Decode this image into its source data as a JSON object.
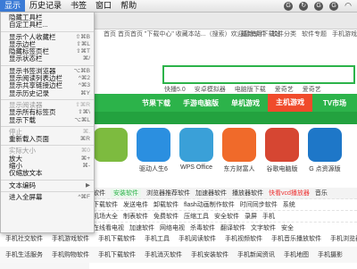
{
  "menubar": {
    "items": [
      "显示",
      "历史记录",
      "书签",
      "窗口",
      "帮助"
    ],
    "active_index": 0
  },
  "status_icons": [
    "g-icon",
    "refresh-icon",
    "g-icon",
    "g-icon",
    "wifi-icon"
  ],
  "infobar": {
    "left": "首页 首页首页 \"下载中心\" 收藏本站...（搜索）欢迎您使用下载站",
    "links": [
      "最新软件",
      "软件分类",
      "软件专题",
      "手机游戏"
    ]
  },
  "hot_links": [
    "快播5.0",
    "安卓模拟器",
    "电脑版下载",
    "爱奇艺",
    "爱奇艺"
  ],
  "nav": [
    "",
    "节果下载",
    "手游电脑版",
    "单机游戏",
    "主机游戏",
    "TV市场"
  ],
  "nav_hot_index": 4,
  "apps": [
    {
      "label": "",
      "color": "#7dbb3f"
    },
    {
      "label": "驱动人生6",
      "color": "#2b8fe0"
    },
    {
      "label": "WPS Office",
      "color": "#3aa0d8"
    },
    {
      "label": "东方财富人",
      "color": "#f06a2a"
    },
    {
      "label": "谷歌电脑版",
      "color": "#d64632"
    },
    {
      "label": "G 点资源版",
      "color": "#1e77c8"
    }
  ],
  "categories": [
    {
      "items": [
        "软件",
        "安装软件",
        "浏览器推荐软件",
        "加速器软件",
        "播放器软件",
        "快看vcd播放器",
        "音乐"
      ],
      "green_index": 1,
      "red_index": 5
    },
    {
      "items": [
        "下载软件",
        "发送电件",
        "卸载软件",
        "flash动画制作软件",
        "时间同步软件",
        "系统"
      ],
      "green_index": -1,
      "red_index": -1
    },
    {
      "items": [
        "机场大全",
        "制表软件",
        "免费软件",
        "压缩工具",
        "安全软件",
        "录屏",
        "手机"
      ],
      "green_index": -1,
      "red_index": -1
    },
    {
      "items": [
        "在线看电视",
        "加速软件",
        "网络电视",
        "杀毒软件",
        "翻译软件",
        "文字软件",
        "安全"
      ],
      "green_index": -1,
      "red_index": -1
    },
    {
      "items": [
        "文件",
        "电视直播",
        "下载工具",
        "电脑工具",
        "截图软件",
        "加速"
      ],
      "green_index": -1,
      "red_index": -1
    }
  ],
  "bottom_rows": [
    [
      "手机社交软件",
      "手机游戏软件",
      "手机下载软件",
      "手机工具",
      "手机阅读软件",
      "手机视频软件",
      "手机音乐播放软件",
      "手机浏览器"
    ],
    [
      "手机生活服务",
      "手机购物软件",
      "手机下载软件",
      "手机消灭软件",
      "手机安装软件",
      "手机新闻资讯",
      "手机地图",
      "手机摄影"
    ]
  ],
  "menu": {
    "groups": [
      [
        {
          "label": "隐藏工具栏",
          "shortcut": "",
          "enabled": true
        },
        {
          "label": "自定工具栏...",
          "shortcut": "",
          "enabled": true
        }
      ],
      [
        {
          "label": "显示个人收藏栏",
          "shortcut": "⇧⌘B",
          "enabled": true
        },
        {
          "label": "显示边栏",
          "shortcut": "⇧⌘L",
          "enabled": true
        },
        {
          "label": "隐藏标签页栏",
          "shortcut": "⇧⌘T",
          "enabled": true
        },
        {
          "label": "显示状态栏",
          "shortcut": "⌘/",
          "enabled": true
        }
      ],
      [
        {
          "label": "显示书签浏览器",
          "shortcut": "⌥⌘B",
          "enabled": true
        },
        {
          "label": "显示阅读列表边栏",
          "shortcut": "^⌘2",
          "enabled": true
        },
        {
          "label": "显示共享链接边栏",
          "shortcut": "^⌘3",
          "enabled": true
        },
        {
          "label": "显示历史记录",
          "shortcut": "⌘Y",
          "enabled": true
        }
      ],
      [
        {
          "label": "显示阅读器",
          "shortcut": "⇧⌘R",
          "enabled": false
        },
        {
          "label": "显示所有标签页",
          "shortcut": "⇧⌘\\",
          "enabled": true
        },
        {
          "label": "显示下载",
          "shortcut": "⌥⌘L",
          "enabled": true
        }
      ],
      [
        {
          "label": "停止",
          "shortcut": "⌘.",
          "enabled": false
        },
        {
          "label": "重新载入页面",
          "shortcut": "⌘R",
          "enabled": true
        }
      ],
      [
        {
          "label": "实际大小",
          "shortcut": "⌘0",
          "enabled": false
        },
        {
          "label": "放大",
          "shortcut": "⌘+",
          "enabled": true
        },
        {
          "label": "缩小",
          "shortcut": "⌘-",
          "enabled": true
        },
        {
          "label": "仅缩放文本",
          "shortcut": "",
          "enabled": true
        }
      ],
      [
        {
          "label": "文本编码",
          "shortcut": "▶",
          "enabled": true
        }
      ],
      [
        {
          "label": "进入全屏幕",
          "shortcut": "^⌘F",
          "enabled": true
        }
      ]
    ]
  }
}
